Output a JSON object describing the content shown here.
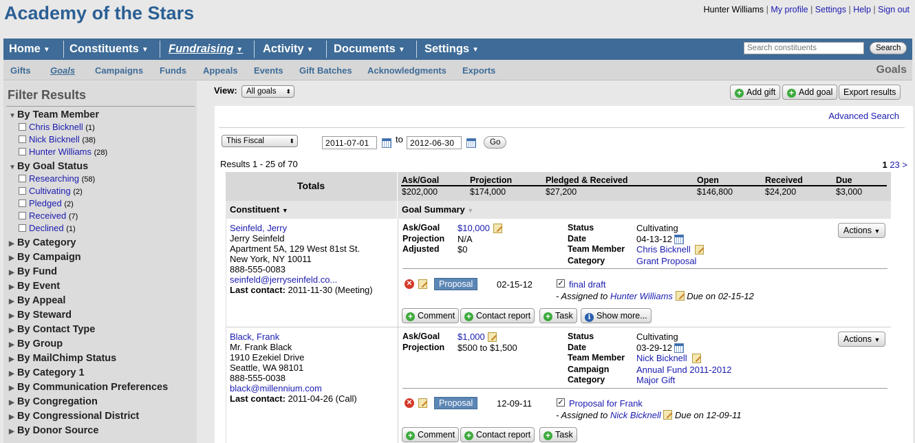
{
  "app": {
    "title": "Academy of the Stars"
  },
  "user_links": {
    "name": "Hunter Williams",
    "profile": "My profile",
    "settings": "Settings",
    "help": "Help",
    "signout": "Sign out",
    "sep": "|"
  },
  "main_nav": {
    "items": [
      {
        "label": "Home"
      },
      {
        "label": "Constituents"
      },
      {
        "label": "Fundraising"
      },
      {
        "label": "Activity"
      },
      {
        "label": "Documents"
      },
      {
        "label": "Settings"
      }
    ],
    "search_placeholder": "Search constituents",
    "search_button": "Search"
  },
  "sub_nav": {
    "items": [
      {
        "label": "Gifts"
      },
      {
        "label": "Goals"
      },
      {
        "label": "Campaigns"
      },
      {
        "label": "Funds"
      },
      {
        "label": "Appeals"
      },
      {
        "label": "Events"
      },
      {
        "label": "Gift Batches"
      },
      {
        "label": "Acknowledgments"
      },
      {
        "label": "Exports"
      }
    ],
    "page_heading": "Goals"
  },
  "filters": {
    "title": "Filter Results",
    "team_member": {
      "label": "By Team Member",
      "items": [
        {
          "name": "Chris Bicknell",
          "count": "(1)"
        },
        {
          "name": "Nick Bicknell",
          "count": "(38)"
        },
        {
          "name": "Hunter Williams",
          "count": "(28)"
        }
      ]
    },
    "goal_status": {
      "label": "By Goal Status",
      "items": [
        {
          "name": "Researching",
          "count": "(58)"
        },
        {
          "name": "Cultivating",
          "count": "(2)"
        },
        {
          "name": "Pledged",
          "count": "(2)"
        },
        {
          "name": "Received",
          "count": "(7)"
        },
        {
          "name": "Declined",
          "count": "(1)"
        }
      ]
    },
    "collapsed": [
      "By Category",
      "By Campaign",
      "By Fund",
      "By Event",
      "By Appeal",
      "By Steward",
      "By Contact Type",
      "By Group",
      "By MailChimp Status",
      "By Category 1",
      "By Communication Preferences",
      "By Congregation",
      "By Congressional District",
      "By Donor Source"
    ]
  },
  "toolbar": {
    "view_label": "View:",
    "view_value": "All goals",
    "add_gift": "Add gift",
    "add_goal": "Add goal",
    "export": "Export results"
  },
  "search_bar": {
    "advanced": "Advanced Search",
    "period": "This Fiscal",
    "from": "2011-07-01",
    "to_label": "to",
    "to": "2012-06-30",
    "go": "Go"
  },
  "results": {
    "summary": "Results 1 - 25 of 70",
    "pages": [
      "1",
      "2",
      "3",
      ">"
    ]
  },
  "totals": {
    "label": "Totals",
    "columns": [
      {
        "label": "Ask/Goal",
        "value": "$202,000"
      },
      {
        "label": "Projection",
        "value": "$174,000"
      },
      {
        "label": "Pledged & Received",
        "value": "$27,200"
      },
      {
        "label": "Open",
        "value": "$146,800"
      },
      {
        "label": "Received",
        "value": "$24,200"
      },
      {
        "label": "Due",
        "value": "$3,000"
      }
    ]
  },
  "headers": {
    "constituent": "Constituent",
    "goal_summary": "Goal Summary"
  },
  "labels": {
    "ask_goal": "Ask/Goal",
    "projection": "Projection",
    "adjusted": "Adjusted",
    "status": "Status",
    "date": "Date",
    "team_member": "Team Member",
    "campaign": "Campaign",
    "category": "Category",
    "last_contact": "Last contact:",
    "actions": "Actions",
    "assigned_to": "- Assigned to",
    "due_on": "Due on",
    "comment": "Comment",
    "contact_report": "Contact report",
    "task": "Task",
    "show_more": "Show more..."
  },
  "rows": [
    {
      "link_name": "Seinfeld, Jerry",
      "full_name": "Jerry Seinfeld",
      "address1": "Apartment 5A, 129 West 81st St.",
      "address2": "New York, NY 10011",
      "phone": "888-555-0083",
      "email": "seinfeld@jerryseinfeld.co...",
      "last_contact": "2011-11-30 (Meeting)",
      "ask": "$10,000",
      "projection": "N/A",
      "adjusted": "$0",
      "status": "Cultivating",
      "date": "04-13-12",
      "team_member": "Chris Bicknell",
      "category": "Grant Proposal",
      "stage": "Proposal",
      "stage_date": "02-15-12",
      "task": "final draft",
      "assignee": "Hunter Williams",
      "due": "02-15-12"
    },
    {
      "link_name": "Black, Frank",
      "full_name": "Mr. Frank Black",
      "address1": "1910 Ezekiel Drive",
      "address2": "Seattle, WA 98101",
      "phone": "888-555-0038",
      "email": "black@millennium.com",
      "last_contact": "2011-04-26 (Call)",
      "ask": "$1,000",
      "projection": "$500 to $1,500",
      "status": "Cultivating",
      "date": "03-29-12",
      "team_member": "Nick Bicknell",
      "campaign": "Annual Fund 2011-2012",
      "category": "Major Gift",
      "stage": "Proposal",
      "stage_date": "12-09-11",
      "task": "Proposal for Frank",
      "assignee": "Nick Bicknell",
      "due": "12-09-11"
    }
  ]
}
